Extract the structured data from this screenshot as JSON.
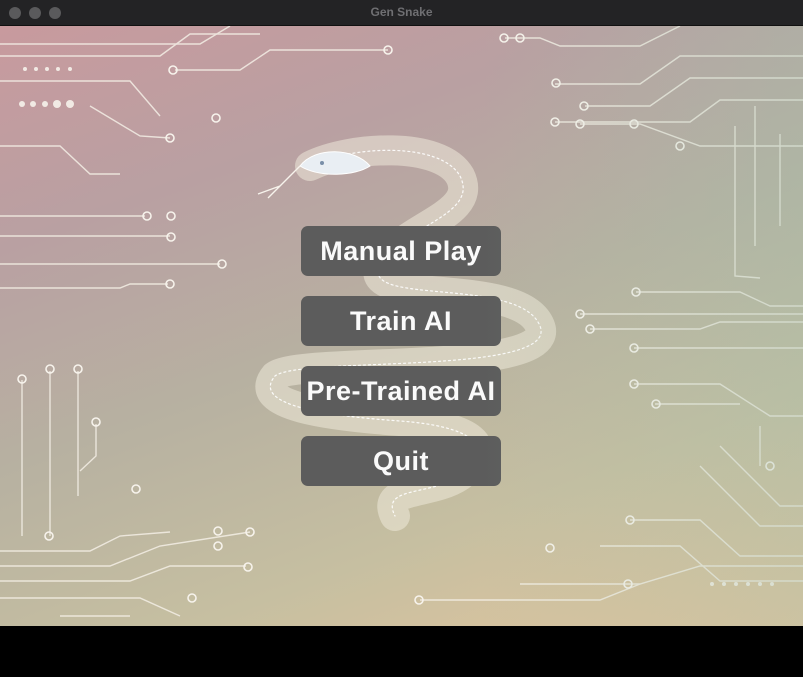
{
  "window": {
    "title": "Gen Snake"
  },
  "menu": {
    "buttons": [
      {
        "label": "Manual Play"
      },
      {
        "label": "Train AI"
      },
      {
        "label": "Pre-Trained AI"
      },
      {
        "label": "Quit"
      }
    ]
  },
  "colors": {
    "button_bg": "#5c5c5c",
    "button_text": "#fafafa",
    "titlebar": "#232325"
  },
  "icons": {
    "background": "snake-circuit-illustration"
  }
}
